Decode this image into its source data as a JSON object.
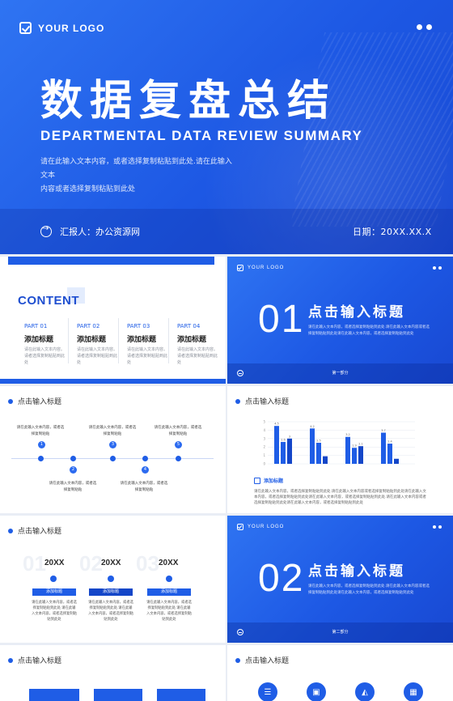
{
  "hero": {
    "logo_text": "YOUR LOGO",
    "title": "数据复盘总结",
    "subtitle": "DEPARTMENTAL DATA REVIEW SUMMARY",
    "desc_line1": "请在此输入文本内容，或者选择复制粘贴到此处.请在此输入文本",
    "desc_line2": "内容或者选择复制粘贴到此处",
    "reporter": "汇报人：办公资源网",
    "date": "日期：20XX.XX.X"
  },
  "content_slide": {
    "title": "CONTENT",
    "parts": [
      {
        "num": "PART 01",
        "title": "添加标题",
        "desc": "请在此输入文本内容。请者选择复制粘贴到此处"
      },
      {
        "num": "PART 02",
        "title": "添加标题",
        "desc": "请在此输入文本内容。请者选择复制粘贴到此处"
      },
      {
        "num": "PART 03",
        "title": "添加标题",
        "desc": "请在此输入文本内容。请者选择复制粘贴到此处"
      },
      {
        "num": "PART 04",
        "title": "添加标题",
        "desc": "请在此输入文本内容。请者选择复制粘贴到此处"
      }
    ]
  },
  "section1": {
    "logo_text": "YOUR LOGO",
    "num": "01",
    "title": "点击输入标题",
    "desc": "请在此输入文本内容，或者选择复制粘贴到此处.请在此输入文本内容或者选择复制粘贴到此处请在此输入文本内容，或者选择复制粘贴到此处",
    "part_label": "第一部分"
  },
  "timeline_slide": {
    "heading": "点击输入标题",
    "items": [
      {
        "n": "1",
        "text": "请在此输入文本内容，或者选择复制粘贴"
      },
      {
        "n": "2",
        "text": "请在此输入文本内容，或者选择复制粘贴"
      },
      {
        "n": "3",
        "text": "请在此输入文本内容，或者选择复制粘贴"
      },
      {
        "n": "4",
        "text": "请在此输入文本内容，或者选择复制粘贴"
      },
      {
        "n": "5",
        "text": "请在此输入文本内容，或者选择复制粘贴"
      }
    ]
  },
  "chart_slide": {
    "heading": "点击输入标题",
    "tag": "添加标题",
    "desc": "请在此输入文本内容，或者选择复制粘贴到此处.请在此输入文本内容或者选择复制粘贴到此处请在此输入文本内容，或者选择复制粘贴到此处请在此输入文本内容，或者选择复制粘贴到此处.请在此输入文本内容或者选择复制粘贴到此处请在此输入文本内容，或者选择复制粘贴到此处"
  },
  "chart_data": {
    "type": "bar",
    "categories": [
      "A",
      "B",
      "C",
      "D"
    ],
    "series": [
      {
        "values": [
          4.5,
          4.2,
          3.2,
          3.7
        ],
        "color": "#1f5de6"
      },
      {
        "values": [
          2.6,
          2.5,
          1.9,
          2.4
        ],
        "color": "#1f5de6"
      },
      {
        "values": [
          3.0,
          0.9,
          2.1,
          0.6
        ],
        "color": "#1446c8"
      }
    ],
    "ylim": [
      0,
      5
    ],
    "yticks": [
      "0",
      "1",
      "2",
      "3",
      "4",
      "5"
    ],
    "labels": [
      [
        "4.5",
        "2.6",
        "3"
      ],
      [
        "4.2",
        "2.5",
        ""
      ],
      [
        "3.2",
        "1.9",
        "2.1"
      ],
      [
        "3.7",
        "2.4",
        ""
      ]
    ]
  },
  "section2": {
    "logo_text": "YOUR LOGO",
    "num": "02",
    "title": "点击输入标题",
    "desc": "请在此输入文本内容，或者选择复制粘贴到此处.请在此输入文本内容或者选择复制粘贴到此处请在此输入文本内容，或者选择复制粘贴到此处",
    "part_label": "第二部分"
  },
  "steps_slide": {
    "heading": "点击输入标题",
    "steps": [
      {
        "bg": "01",
        "year": "20XX",
        "btn": "添加标题",
        "text": "请在此输入文本内容，或者选择复制粘贴到此处.请在此输入文本内容，或者选择复制粘贴到此处"
      },
      {
        "bg": "02",
        "year": "20XX",
        "btn": "添加标题",
        "text": "请在此输入文本内容，或者选择复制粘贴到此处.请在此输入文本内容，或者选择复制粘贴到此处"
      },
      {
        "bg": "03",
        "year": "20XX",
        "btn": "添加标题",
        "text": "请在此输入文本内容，或者选择复制粘贴到此处.请在此输入文本内容，或者选择复制粘贴到此处"
      }
    ]
  },
  "slide7": {
    "heading": "点击输入标题"
  },
  "slide8": {
    "heading": "点击输入标题",
    "icons": [
      "server-icon",
      "bag-icon",
      "chart-icon",
      "calendar-icon"
    ]
  }
}
